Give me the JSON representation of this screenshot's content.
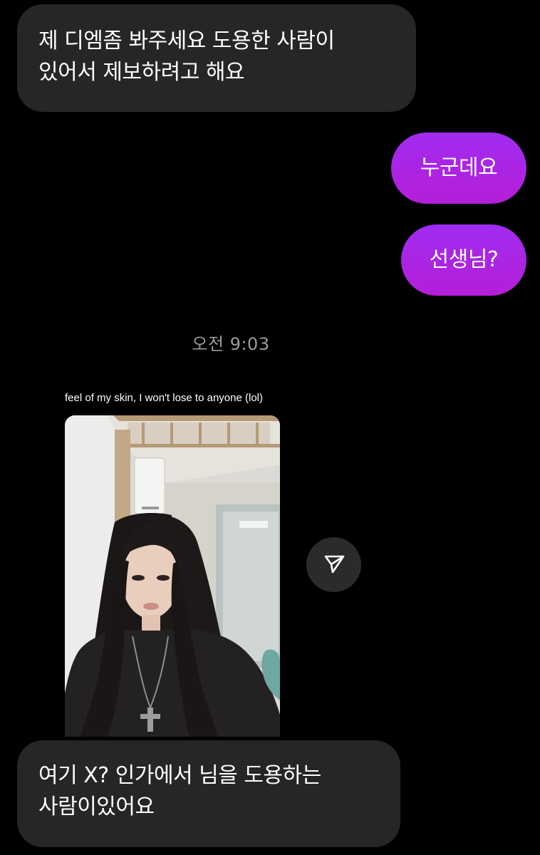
{
  "messages": [
    {
      "direction": "incoming",
      "lines": [
        "제 디엠좀 봐주세요 도용한 사람이",
        "있어서 제보하려고 해요"
      ]
    },
    {
      "direction": "outgoing",
      "lines": [
        "누군데요"
      ]
    },
    {
      "direction": "outgoing",
      "lines": [
        "선생님?"
      ]
    },
    {
      "direction": "incoming",
      "lines": [
        "여기 X? 인가에서 님을 도용하는",
        "사람이있어요"
      ]
    }
  ],
  "timestamp": "오전 9:03",
  "shared_post": {
    "caption": "feel of my skin, I won't lose to anyone (lol)"
  },
  "icons": {
    "share": "send-arrow-icon"
  },
  "colors": {
    "background": "#000000",
    "incoming_bubble": "#262626",
    "outgoing_bubble": "#a625e0",
    "timestamp_text": "#9a9a9a"
  }
}
